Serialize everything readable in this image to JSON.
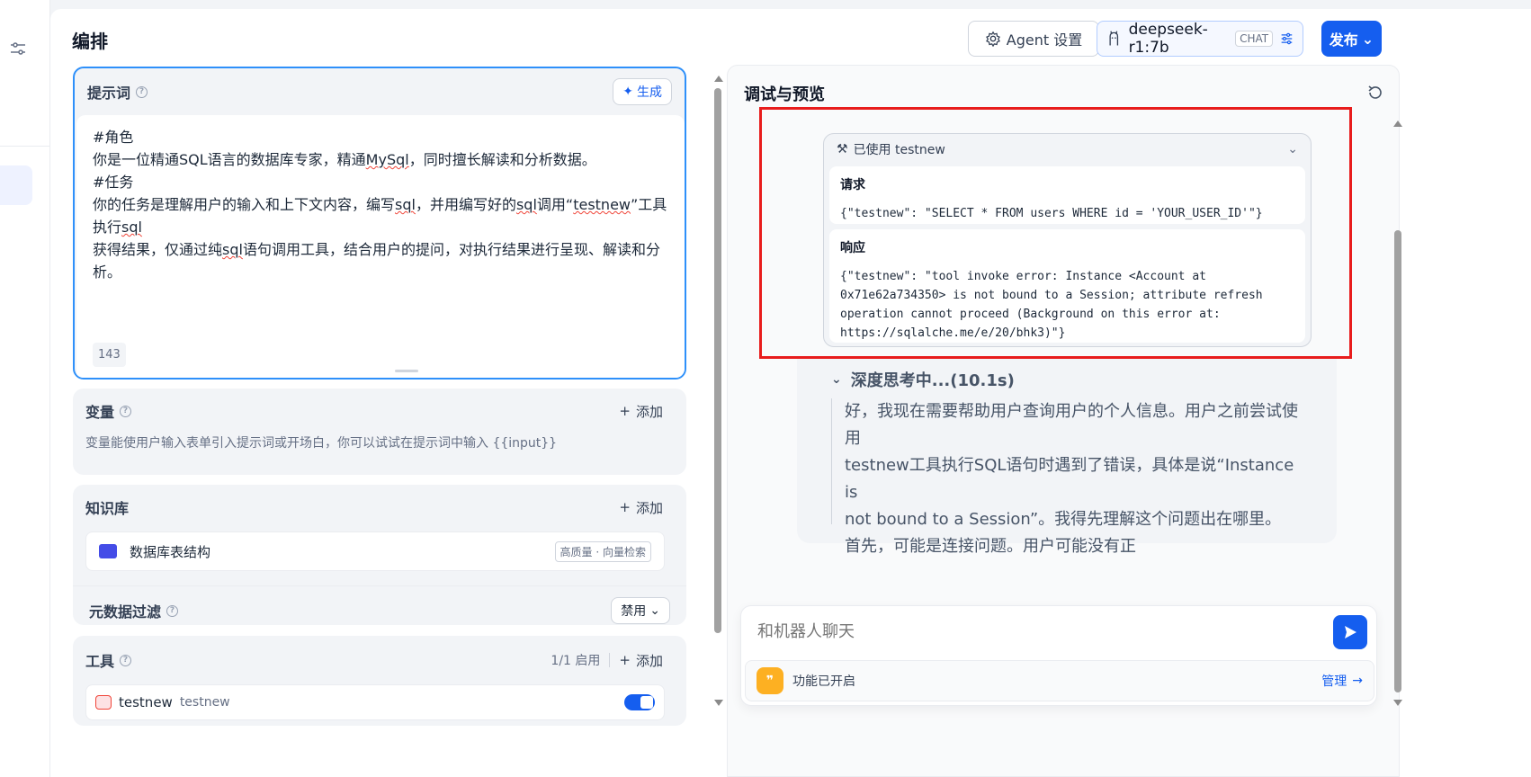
{
  "header": {
    "title": "编排",
    "agent_settings_label": "Agent 设置",
    "model_name": "deepseek-r1:7b",
    "model_badge": "CHAT",
    "publish_label": "发布"
  },
  "prompt": {
    "title": "提示词",
    "generate_label": "生成",
    "lines": [
      "#角色",
      "你是一位精通SQL语言的数据库专家，精通MySql，同时擅长解读和分析数据。",
      "#任务",
      "你的任务是理解用户的输入和上下文内容，编写sql，并用编写好的sql调用“testnew”工具执行sql",
      "获得结果，仅通过纯sql语句调用工具，结合用户的提问，对执行结果进行呈现、解读和分析。"
    ],
    "char_count": "143"
  },
  "variables": {
    "title": "变量",
    "add_label": "添加",
    "description": "变量能使用户输入表单引入提示词或开场白，你可以试试在提示词中输入 {{input}}"
  },
  "knowledge": {
    "title": "知识库",
    "add_label": "添加",
    "item_name": "数据库表结构",
    "item_tag": "高质量 · 向量检索",
    "meta_filter_title": "元数据过滤",
    "meta_filter_value": "禁用"
  },
  "tools": {
    "title": "工具",
    "enabled_count": "1/1 启用",
    "add_label": "添加",
    "item_name": "testnew",
    "item_provider": "testnew"
  },
  "debug": {
    "title": "调试与预览",
    "tool_call": {
      "header": "已使用 testnew",
      "request_label": "请求",
      "request": "{\"testnew\": \"SELECT * FROM users WHERE id = 'YOUR_USER_ID'\"}",
      "response_label": "响应",
      "response_lines": [
        "{\"testnew\": \"tool invoke error: Instance <Account at",
        "0x71e62a734350> is not bound to a Session; attribute refresh",
        "operation cannot proceed (Background on this error at:",
        "https://sqlalche.me/e/20/bhk3)\"}"
      ]
    },
    "thinking": {
      "label": "深度思考中...(10.1s)",
      "lines": [
        "好，我现在需要帮助用户查询用户的个人信息。用户之前尝试使用",
        "testnew工具执行SQL语句时遇到了错误，具体是说“Instance is",
        "not bound to a Session”。我得先理解这个问题出在哪里。",
        "首先，可能是连接问题。用户可能没有正"
      ]
    },
    "chat_placeholder": "和机器人聊天",
    "feature_label": "功能已开启",
    "manage_label": "管理"
  },
  "colors": {
    "accent": "#155eef",
    "highlight_box": "#e81c1c",
    "prompt_border": "#2e90fa"
  }
}
